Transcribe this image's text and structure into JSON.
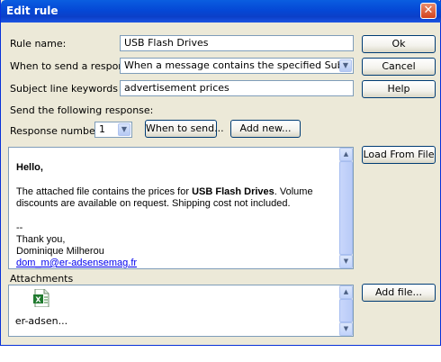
{
  "window": {
    "title": "Edit rule"
  },
  "form": {
    "rule_name_label": "Rule name:",
    "rule_name_value": "USB Flash Drives",
    "when_label": "When to send a response:",
    "when_value": "When a message contains the specified Subject",
    "keywords_label": "Subject line keywords",
    "keywords_value": "advertisement prices",
    "send_following_label": "Send the following response:",
    "response_number_label": "Response number:",
    "response_number_value": "1",
    "when_to_send_button": "When to send...",
    "add_new_button": "Add new..."
  },
  "buttons": {
    "ok": "Ok",
    "cancel": "Cancel",
    "help": "Help",
    "load_from_file": "Load From File",
    "add_file": "Add file..."
  },
  "message": {
    "greeting": "Hello,",
    "body_prefix": "The attached file contains the prices for ",
    "body_bold": "USB Flash Drives",
    "body_suffix": ". Volume discounts are available on request. Shipping cost not included.",
    "separator": "--",
    "thanks": "Thank you,",
    "signature_name": "Dominique Milherou",
    "signature_email": "dom_m@er-adsensemag.fr"
  },
  "attachments": {
    "label": "Attachments",
    "items": [
      {
        "name": "er-adsen...",
        "icon": "excel-file-icon"
      }
    ]
  }
}
